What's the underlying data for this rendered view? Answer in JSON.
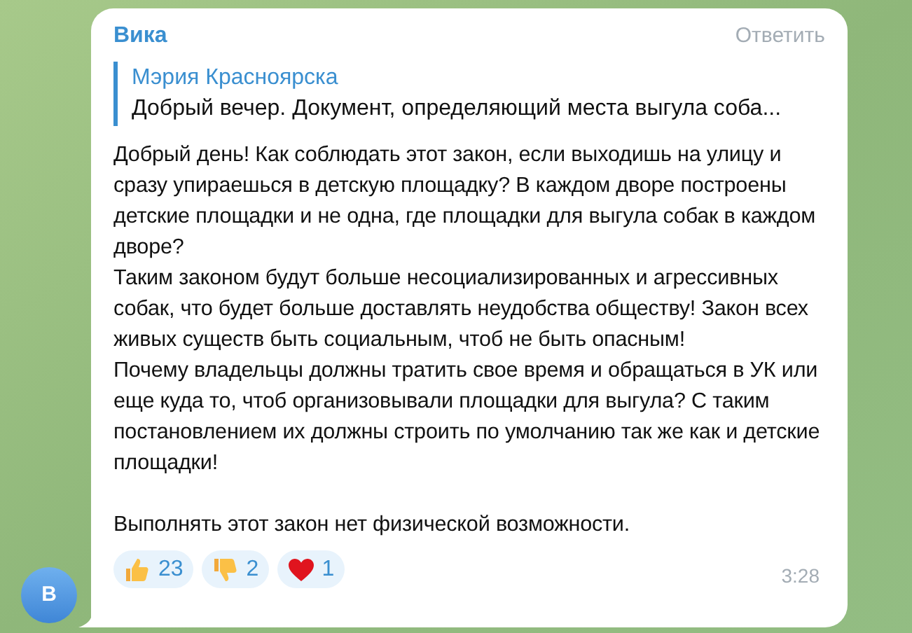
{
  "message": {
    "author": "Вика",
    "reply_action": "Ответить",
    "quote": {
      "author": "Мэрия Красноярска",
      "text": "Добрый вечер. Документ, определяющий места выгула соба..."
    },
    "paragraphs": [
      "Добрый день! Как соблюдать этот закон, если выходишь на улицу и сразу упираешься в детскую площадку? В каждом дворе построены детские площадки и не одна, где площадки для выгула собак в каждом дворе?",
      "Таким законом будут больше несоциализированных и агрессивных собак, что будет больше доставлять неудобства обществу! Закон всех живых существ быть социальным, чтоб не быть опасным!",
      "Почему владельцы должны тратить свое время и обращаться в УК или еще куда то, чтоб организовывали площадки для выгула? С таким постановлением их должны строить по умолчанию так же как и детские площадки!",
      "Выполнять этот закон нет физической возможности."
    ],
    "reactions": [
      {
        "kind": "thumbs_up",
        "count": "23"
      },
      {
        "kind": "thumbs_down",
        "count": "2"
      },
      {
        "kind": "heart",
        "count": "1"
      }
    ],
    "time": "3:28"
  },
  "avatar": {
    "letter": "В"
  }
}
